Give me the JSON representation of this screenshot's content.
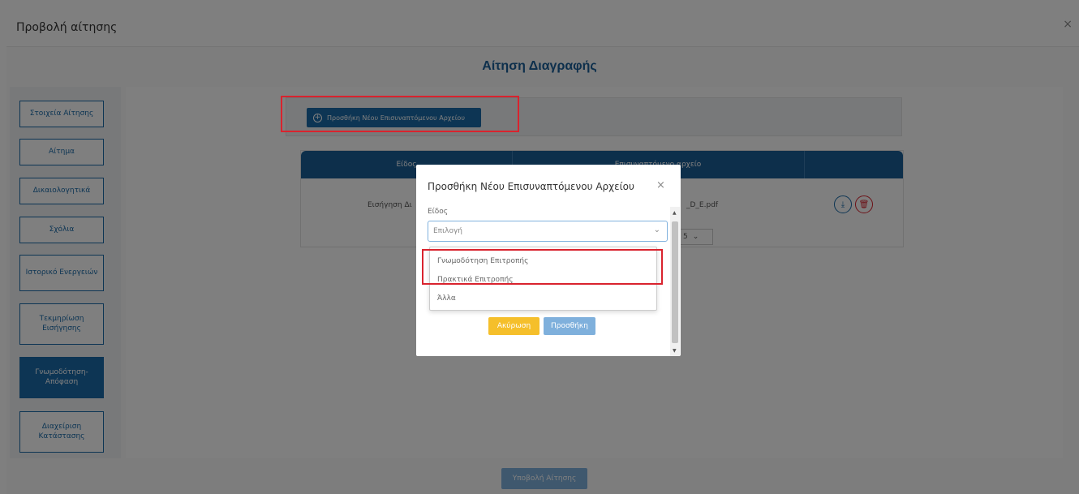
{
  "page": {
    "title": "Προβολή αίτησης",
    "close_icon": "×",
    "form_title": "Αίτηση Διαγραφής"
  },
  "sidebar": {
    "items": [
      {
        "label": "Στοιχεία Αίτησης",
        "active": false
      },
      {
        "label": "Αίτημα",
        "active": false
      },
      {
        "label": "Δικαιολογητικά",
        "active": false
      },
      {
        "label": "Σχόλια",
        "active": false
      },
      {
        "label": "Ιστορικό Ενεργειών",
        "active": false
      },
      {
        "label": "Τεκμηρίωση Εισήγησης",
        "active": false
      },
      {
        "label": "Γνωμοδότηση-Απόφαση",
        "active": true
      },
      {
        "label": "Διαχείριση Κατάστασης",
        "active": false
      }
    ]
  },
  "toolbar": {
    "add_file_label": "Προσθήκη Νέου Επισυναπτόμενου Αρχείου"
  },
  "table": {
    "headers": [
      "Είδος",
      "Επισυναπτόμενο αρχείο",
      ""
    ],
    "rows": [
      {
        "type": "Εισήγηση Δι",
        "file": "_D_E.pdf"
      }
    ],
    "page_size": "5"
  },
  "footer": {
    "submit_label": "Υποβολή Αίτησης"
  },
  "modal": {
    "title": "Προσθήκη Νέου Επισυναπτόμενου Αρχείου",
    "close_icon": "×",
    "field_label": "Είδος",
    "select_value": "Επιλογή",
    "options": [
      "Γνωμοδότηση Επιτροπής",
      "Πρακτικά Επιτροπής",
      "Άλλα"
    ],
    "cancel_label": "Ακύρωση",
    "add_label": "Προσθήκη"
  },
  "colors": {
    "primary": "#1b6ba8",
    "header_blue": "#1b5e96",
    "highlight_red": "#d9232e",
    "cancel_yellow": "#f5bf2b",
    "light_blue_button": "#7fb0dc"
  },
  "icons": {
    "download": "download-icon",
    "delete": "delete-icon",
    "plus": "plus-circle-icon",
    "chevron": "chevron-down-icon"
  }
}
